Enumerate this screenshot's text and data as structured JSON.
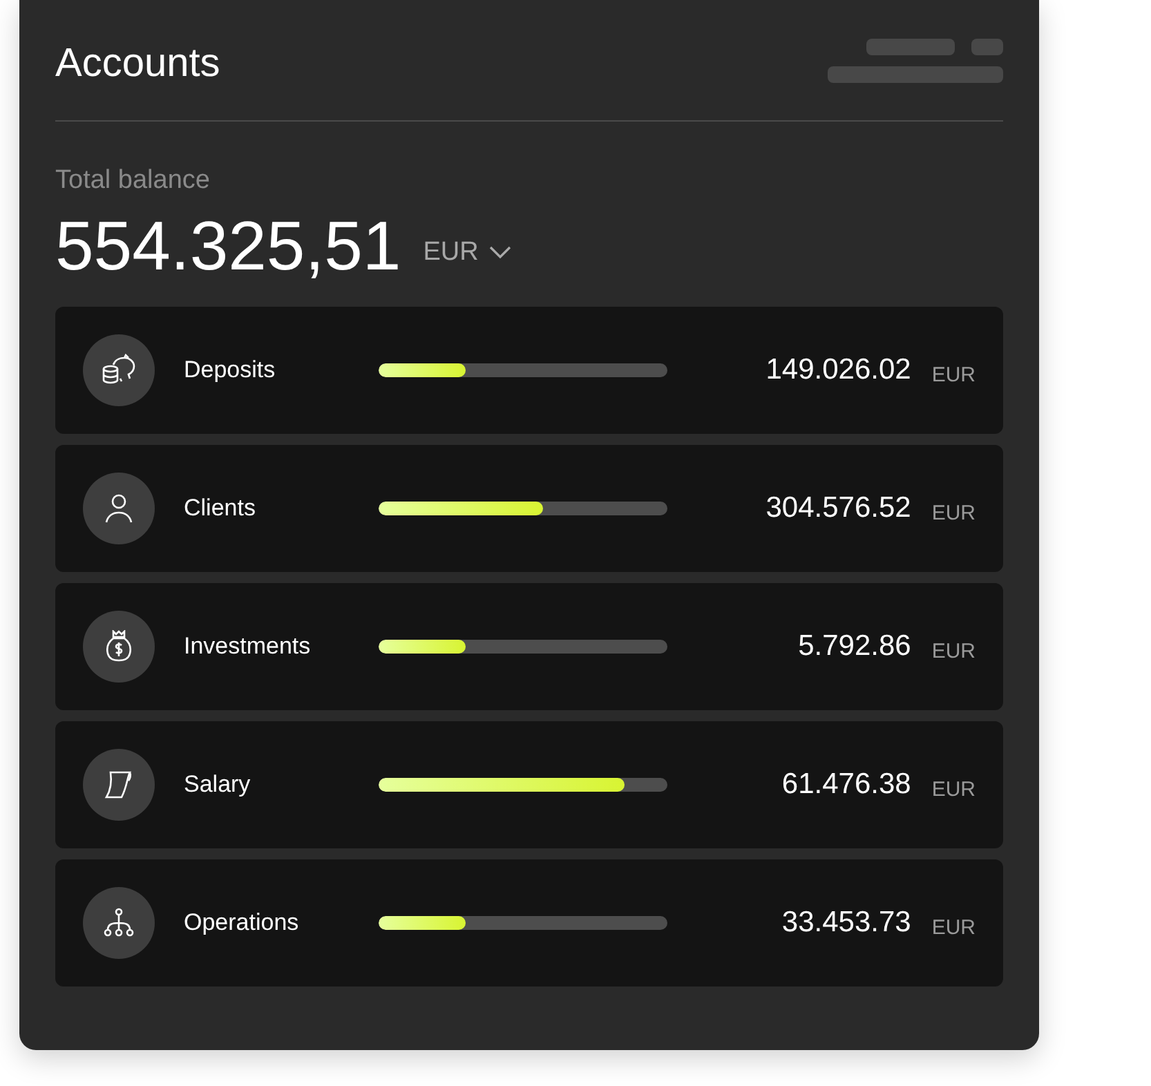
{
  "title": "Accounts",
  "balance": {
    "label": "Total balance",
    "amount": "554.325,51",
    "currency": "EUR"
  },
  "accounts": [
    {
      "name": "Deposits",
      "level": 0.3,
      "amount": "149.026.02",
      "currency": "EUR"
    },
    {
      "name": "Clients",
      "level": 0.57,
      "amount": "304.576.52",
      "currency": "EUR"
    },
    {
      "name": "Investments",
      "level": 0.3,
      "amount": "5.792.86",
      "currency": "EUR"
    },
    {
      "name": "Salary",
      "level": 0.85,
      "amount": "61.476.38",
      "currency": "EUR"
    },
    {
      "name": "Operations",
      "level": 0.3,
      "amount": "33.453.73",
      "currency": "EUR"
    }
  ]
}
